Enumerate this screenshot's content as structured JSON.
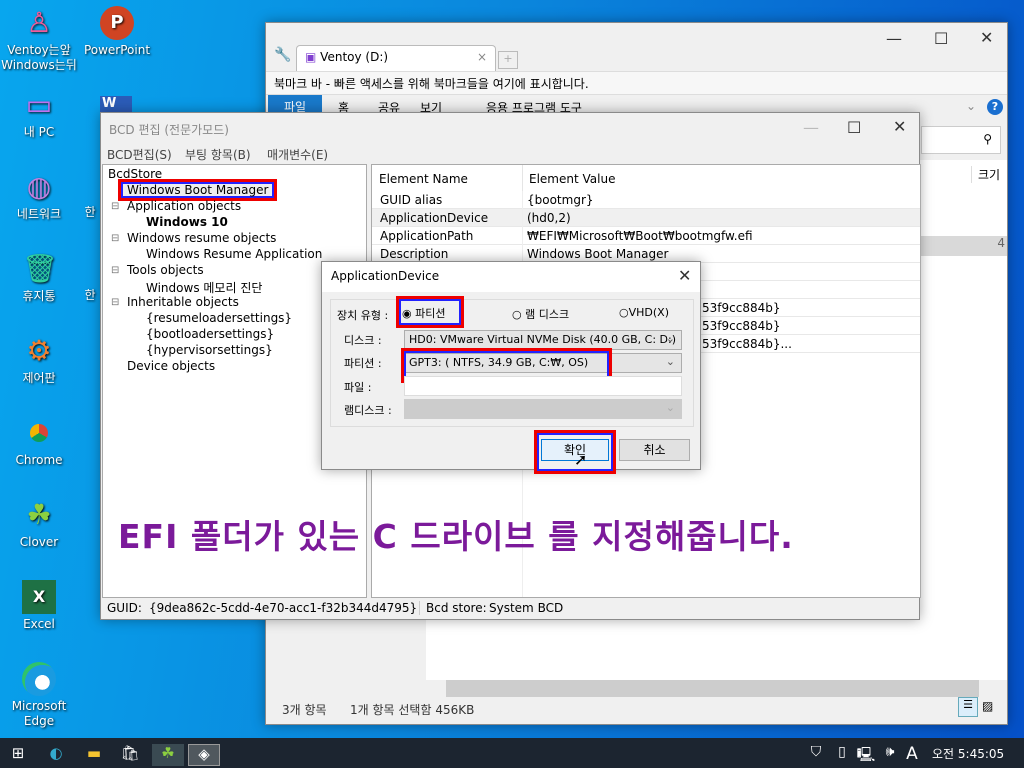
{
  "desktop": {
    "icons": [
      {
        "label": "Ventoy는앞\nWindows는뒤",
        "icon": "hanger-icon"
      },
      {
        "label": "PowerPoint",
        "icon": "powerpoint-icon"
      },
      {
        "label": "내 PC",
        "icon": "monitor-icon"
      },
      {
        "label": "네트워크",
        "icon": "globe-icon"
      },
      {
        "label": "휴지통",
        "icon": "trash-icon"
      },
      {
        "label": "제어판",
        "icon": "gear-icon"
      },
      {
        "label": "Chrome",
        "icon": "chrome-icon"
      },
      {
        "label": "Clover",
        "icon": "clover-icon"
      },
      {
        "label": "Excel",
        "icon": "excel-icon"
      },
      {
        "label": "Microsoft\nEdge",
        "icon": "edge-icon"
      }
    ],
    "partial_labels": [
      "한",
      "한"
    ]
  },
  "explorer": {
    "tab_title": "Ventoy (D:)",
    "bookmark_bar": "북마크 바 - 빠른 액세스를 위해 북마크들을 여기에 표시합니다.",
    "ribbon_tabs": [
      "파일",
      "홈",
      "공유",
      "보기",
      "응용 프로그램 도구"
    ],
    "column_size": "크기",
    "selected_row_partial": "4",
    "status_items": "3개 항목",
    "status_selected": "1개 항목 선택함 456KB"
  },
  "bcd": {
    "title": "BCD 편집 (전문가모드)",
    "menu": [
      "BCD편집(S)",
      "부팅 항목(B)",
      "매개변수(E)"
    ],
    "tree": [
      "BcdStore",
      "Windows Boot Manager",
      "Application objects",
      "Windows 10",
      "Windows resume objects",
      "Windows Resume Application",
      "Tools objects",
      "Windows 메모리 진단",
      "Inheritable objects",
      "{resumeloadersettings}",
      "{bootloadersettings}",
      "{hypervisorsettings}",
      "Device objects"
    ],
    "columns": [
      "Element Name",
      "Element Value"
    ],
    "rows": [
      {
        "name": "GUID alias",
        "value": "{bootmgr}"
      },
      {
        "name": "ApplicationDevice",
        "value": "(hd0,2)"
      },
      {
        "name": "ApplicationPath",
        "value": "₩EFI₩Microsoft₩Boot₩bootmgfw.efi"
      },
      {
        "name": "Description",
        "value": "Windows Boot Manager"
      }
    ],
    "hidden_values": [
      "53f9cc884b}",
      "53f9cc884b}",
      "53f9cc884b}..."
    ],
    "status_guid_label": "GUID:",
    "status_guid": "{9dea862c-5cdd-4e70-acc1-f32b344d4795}",
    "status_store_label": "Bcd store:",
    "status_store": "System BCD"
  },
  "dialog": {
    "title": "ApplicationDevice",
    "device_type_label": "장치 유형 :",
    "radios": [
      {
        "label": "파티션",
        "checked": true
      },
      {
        "label": "램 디스크",
        "checked": false
      },
      {
        "label": "VHD(X)",
        "checked": false
      }
    ],
    "disk_label": "디스크 :",
    "disk_value": "HD0: VMware Virtual NVMe Disk (40.0 GB, C: D:)",
    "partition_label": "파티션 :",
    "partition_value": "GPT3: ( NTFS,  34.9 GB, C:₩, OS)",
    "file_label": "파일 :",
    "file_value": "",
    "ramdisk_label": "램디스크 :",
    "ok": "확인",
    "cancel": "취소"
  },
  "annotation": "EFI 폴더가 있는 C 드라이브 를 지정해줍니다.",
  "taskbar": {
    "clock": "오전 5:45:05",
    "ime": "A"
  },
  "colors": {
    "highlight_outer": "#e00000",
    "highlight_inner": "#2222ff",
    "annotation": "#7b1a9a",
    "ribbon_file": "#1979ca"
  }
}
